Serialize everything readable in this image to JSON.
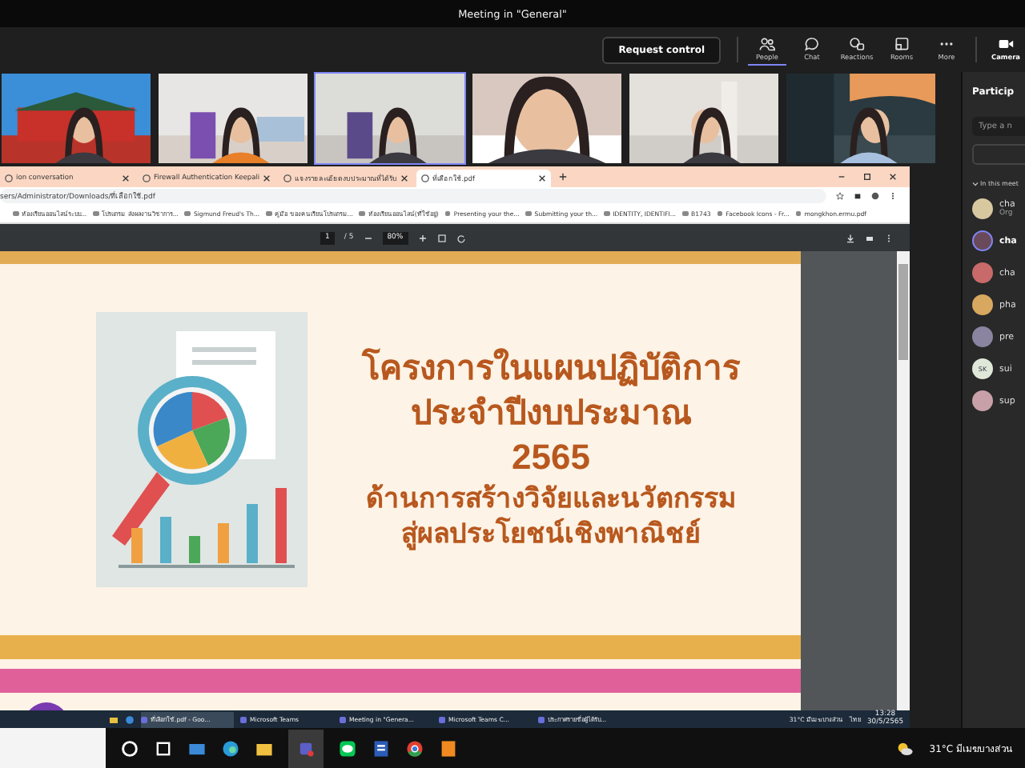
{
  "window": {
    "title": "Meeting in \"General\""
  },
  "toolbar": {
    "request_control": "Request control",
    "items": [
      {
        "kind": "people",
        "label": "People",
        "selected": true
      },
      {
        "kind": "chat",
        "label": "Chat",
        "selected": false
      },
      {
        "kind": "reactions",
        "label": "Reactions",
        "selected": false
      },
      {
        "kind": "rooms",
        "label": "Rooms",
        "selected": false
      },
      {
        "kind": "more",
        "label": "More",
        "selected": false
      },
      {
        "kind": "camera",
        "label": "Camera",
        "selected": false
      }
    ]
  },
  "video_tiles": [
    {
      "kind": "picture",
      "speaking": false
    },
    {
      "kind": "picture",
      "speaking": false
    },
    {
      "kind": "picture",
      "speaking": true
    },
    {
      "kind": "picture",
      "speaking": false
    },
    {
      "kind": "picture",
      "speaking": false
    },
    {
      "kind": "picture",
      "speaking": false
    }
  ],
  "browser": {
    "tabs": [
      {
        "label": "ion conversation",
        "selected": false
      },
      {
        "label": "Firewall Authentication Keepali",
        "selected": false
      },
      {
        "label": "แจงรายละเอียดงบประมาณที่ได้รับ",
        "selected": false
      },
      {
        "label": "ที่เลือกใช้.pdf",
        "selected": true
      }
    ],
    "address": "sers/Administrator/Downloads/ที่เลือกใช้.pdf",
    "bookmarks": [
      "ห้องเรียนออนไลน์ระบบ...",
      "โปรแกรม ส่งผลงานวิชาการ...",
      "Sigmund Freud's Th...",
      "คู่มือ ของคนเรียนโปรแกรม...",
      "ห้องเรียนออนไลน์(ที่ใช้อยู่)",
      "Presenting your the...",
      "Submitting your th...",
      "IDENTITY, IDENTIFI...",
      "B1743",
      "Facebook Icons - Fr...",
      "mongkhon.ermu.pdf"
    ],
    "pdf": {
      "page": "1",
      "pages": "/ 5",
      "zoom": "80%"
    },
    "slide": {
      "lines": [
        {
          "kind": "title",
          "text": "โครงการในแผนปฏิบัติการ"
        },
        {
          "kind": "title",
          "text": "ประจำปีงบประมาณ"
        },
        {
          "kind": "year",
          "text": "2565"
        },
        {
          "kind": "subtitle",
          "text": "ด้านการสร้างวิจัยและนวัตกรรม"
        },
        {
          "kind": "subtitle",
          "text": "สู่ผลประโยชน์เชิงพาณิชย์"
        }
      ]
    }
  },
  "remote_taskbar": {
    "items": [
      {
        "label": "ที่เลือกใช้.pdf - Goo...",
        "active": true
      },
      {
        "label": "Microsoft Teams",
        "active": false
      },
      {
        "label": "Meeting in \"Genera...",
        "active": false
      },
      {
        "label": "Microsoft Teams C...",
        "active": false
      },
      {
        "label": "ประกาศรายชื่อผู้ได้รับ...",
        "active": false
      }
    ],
    "weather": "31°C มีเมฆบางส่วน",
    "language": "ไทย",
    "time": "13:28",
    "date": "30/5/2565"
  },
  "participants": {
    "title": "Particip",
    "search": {
      "placeholder": "Type a n"
    },
    "section": "In this meet",
    "people": [
      {
        "name": "cha",
        "subtitle": "Org",
        "speaking": false
      },
      {
        "name": "cha",
        "speaking": true
      },
      {
        "name": "cha",
        "speaking": false
      },
      {
        "name": "pha",
        "speaking": false
      },
      {
        "name": "pre",
        "speaking": false
      },
      {
        "name": "sui",
        "initials": "SK",
        "speaking": false
      },
      {
        "name": "sup",
        "speaking": false
      }
    ]
  },
  "local_taskbar": {
    "weather": "31°C มีเมฆบางส่วน"
  }
}
